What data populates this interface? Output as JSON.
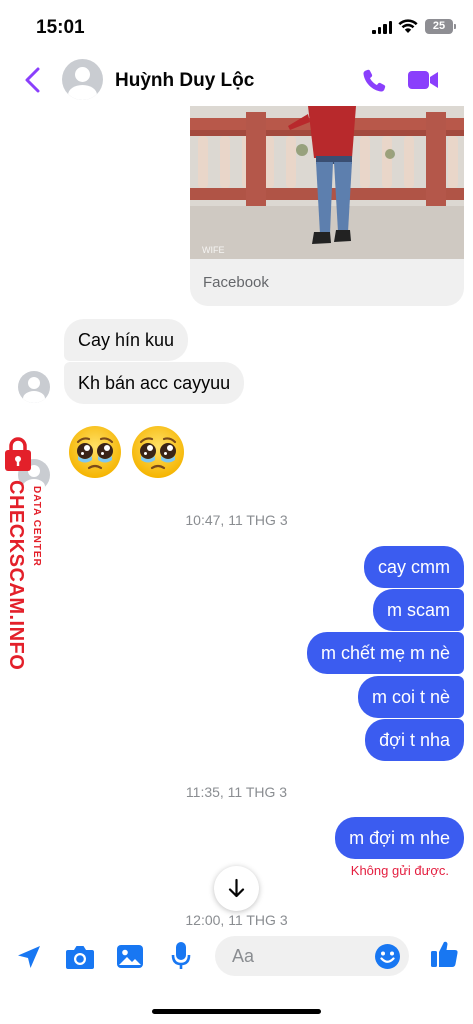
{
  "status_bar": {
    "time": "15:01",
    "battery": "25"
  },
  "header": {
    "contact_name": "Huỳnh Duy Lộc"
  },
  "shared_post": {
    "source": "Facebook",
    "image_caption": "WIFE"
  },
  "messages": {
    "incoming": [
      "Cay hín kuu",
      "Kh bán acc cayyuu"
    ],
    "emoji": [
      "crying-face",
      "crying-face"
    ],
    "timestamps": [
      "10:47, 11 THG 3",
      "11:35, 11 THG 3",
      "12:00, 11 THG 3"
    ],
    "outgoing_group_1": [
      "cay cmm",
      "m scam",
      "m chết mẹ m nè",
      "m coi t nè",
      "đợi t nha"
    ],
    "outgoing_group_2": [
      "m đợi m nhe"
    ],
    "error": "Không gửi được."
  },
  "watermark": {
    "main": "CHECKSCAM.INFO",
    "sub": "DATA CENTER"
  },
  "composer": {
    "placeholder": "Aa"
  },
  "colors": {
    "accent": "#8a3ffc",
    "outgoing_bubble": "#3b5cf0",
    "incoming_bubble": "#f0f0f0",
    "composer_icons": "#1877f2",
    "error": "#e41e3f",
    "watermark": "#e3202a"
  }
}
